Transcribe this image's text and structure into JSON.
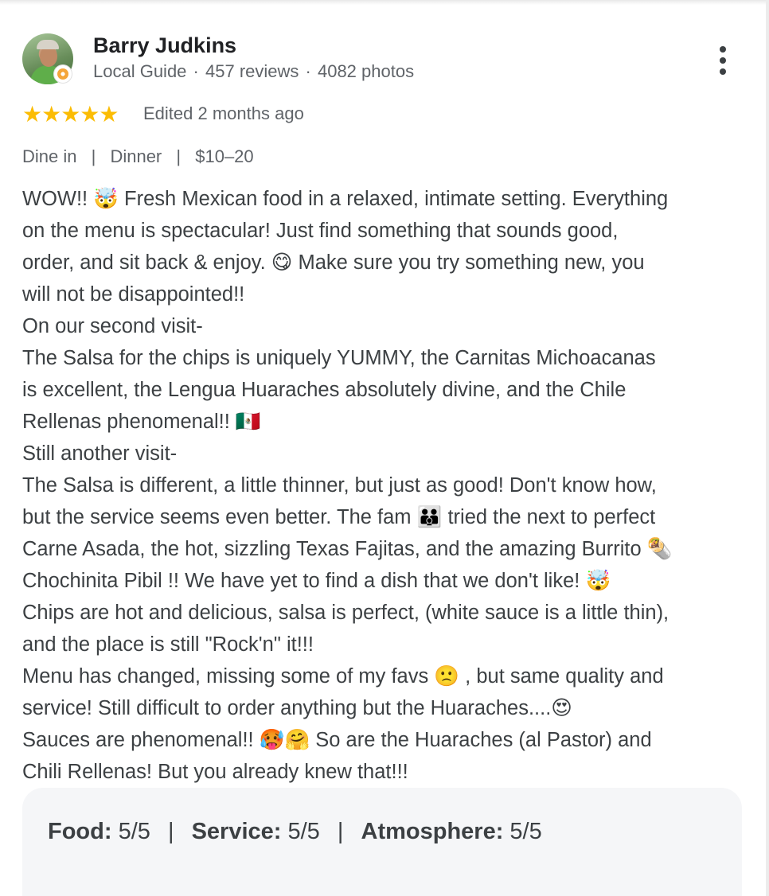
{
  "reviewer": {
    "name": "Barry Judkins",
    "role": "Local Guide",
    "reviews": "457 reviews",
    "photos": "4082 photos",
    "separator": "·"
  },
  "rating": {
    "stars": 5,
    "stars_glyph": "★★★★★",
    "edited": "Edited 2 months ago"
  },
  "attributes": [
    "Dine in",
    "Dinner",
    "$10–20"
  ],
  "attribute_separator": "|",
  "review_lines": [
    "WOW!! 🤯 Fresh Mexican food in a relaxed, intimate setting. Everything",
    "on the menu is spectacular! Just find something that sounds good,",
    "order, and sit back & enjoy. 😋 Make sure you try something new, you",
    "will not be disappointed!!",
    "On our second visit-",
    "The Salsa for the chips is uniquely YUMMY, the Carnitas Michoacanas",
    "is excellent, the Lengua Huaraches absolutely divine, and the Chile",
    "Rellenas phenomenal!! 🇲🇽",
    "Still another visit-",
    "The Salsa is different, a little thinner, but just as good! Don't know how,",
    "but the service seems even better. The fam 👪 tried the next to perfect",
    "Carne Asada, the hot, sizzling Texas Fajitas, and the amazing Burrito 🌯",
    "Chochinita Pibil !! We have yet to find a dish that we don't like! 🤯",
    "Chips are hot and delicious, salsa is perfect, (white sauce is a little thin),",
    "and the place is still \"Rock'n\" it!!!",
    "Menu has changed, missing some of my favs 🙁 , but same quality and",
    "service! Still difficult to order anything but the Huaraches....😍",
    "Sauces are phenomenal!! 🥵🤗 So are the Huaraches (al Pastor) and",
    "Chili Rellenas! But you already knew that!!!"
  ],
  "sub_ratings": [
    {
      "label": "Food:",
      "value": "5/5"
    },
    {
      "label": "Service:",
      "value": "5/5"
    },
    {
      "label": "Atmosphere:",
      "value": "5/5"
    }
  ],
  "sub_rating_separator": "|",
  "colors": {
    "star": "#fbbc04",
    "name": "#202124",
    "meta": "#5f6368",
    "body": "#3c4043",
    "panel": "#f5f6f8"
  },
  "icons": {
    "menu": "more-vert-icon",
    "badge": "local-guide-badge-icon"
  }
}
